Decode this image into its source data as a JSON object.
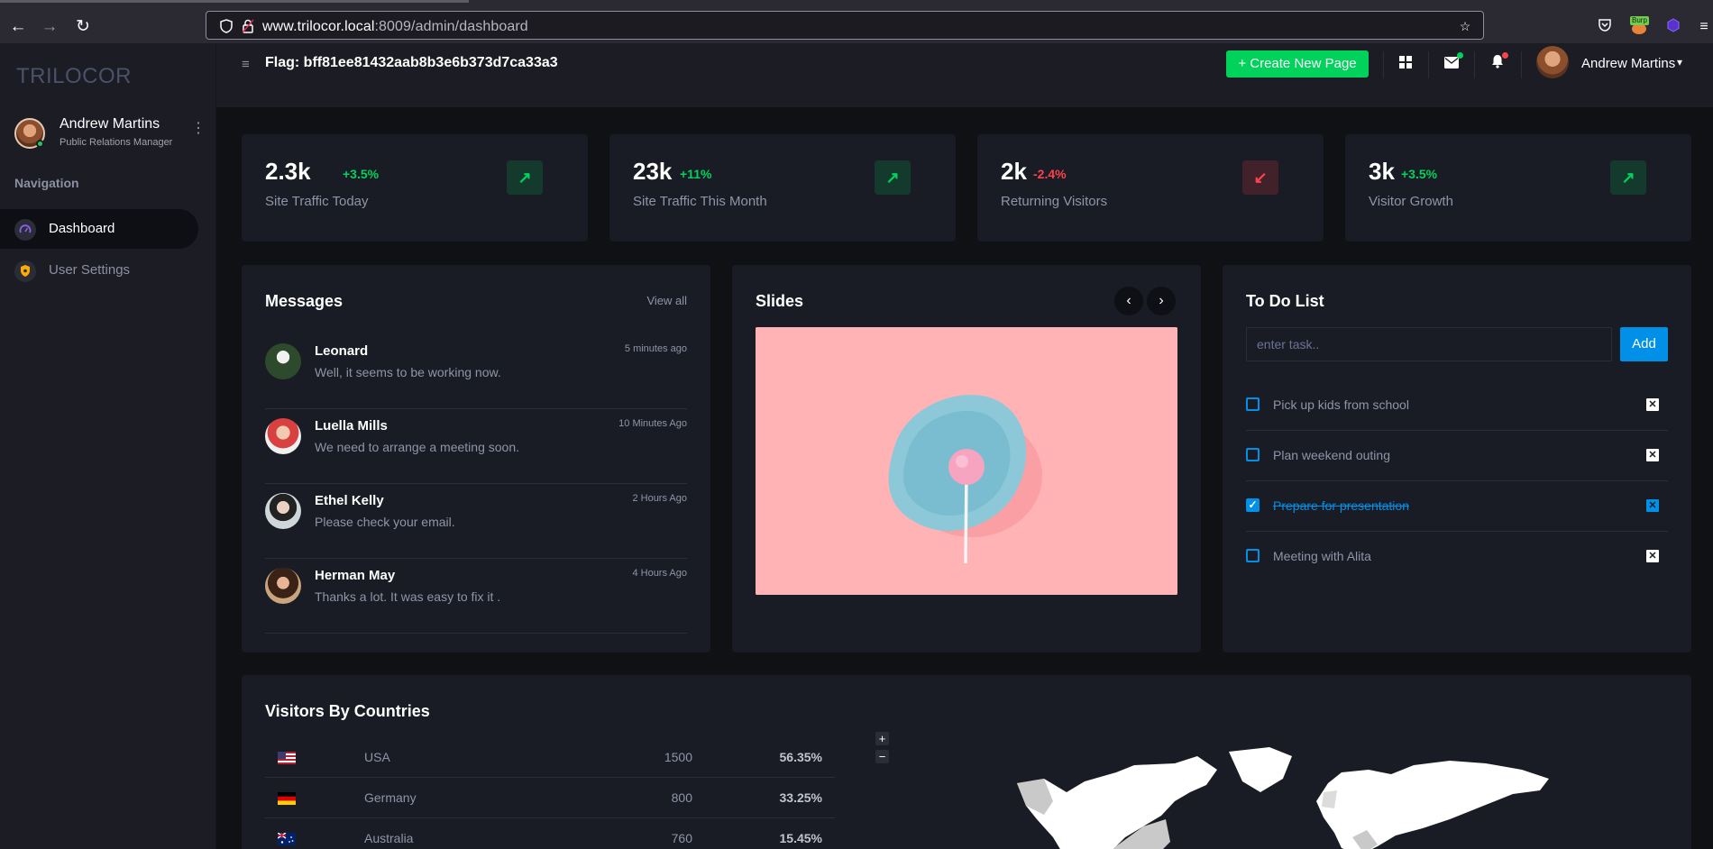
{
  "browser": {
    "url_host": "www.trilocor.local",
    "url_path": ":8009/admin/dashboard",
    "burp_badge": "Burp"
  },
  "brand": {
    "logo": "TRILOCOR"
  },
  "profile": {
    "name": "Andrew Martins",
    "role": "Public Relations Manager"
  },
  "nav": {
    "heading": "Navigation",
    "items": [
      {
        "label": "Dashboard",
        "active": true
      },
      {
        "label": "User Settings",
        "active": false
      }
    ]
  },
  "topbar": {
    "flag": "Flag: bff81ee81432aab8b3e6b373d7ca33a3",
    "create_button": "+ Create New Page",
    "user_name": "Andrew Martins"
  },
  "stats": [
    {
      "value": "2.3k",
      "change": "+3.5%",
      "label": "Site Traffic Today",
      "trend": "up"
    },
    {
      "value": "23k",
      "change": "+11%",
      "label": "Site Traffic This Month",
      "trend": "up"
    },
    {
      "value": "2k",
      "change": "-2.4%",
      "label": "Returning Visitors",
      "trend": "down"
    },
    {
      "value": "3k",
      "change": "+3.5%",
      "label": "Visitor Growth",
      "trend": "up"
    }
  ],
  "messages": {
    "title": "Messages",
    "view_all": "View all",
    "items": [
      {
        "name": "Leonard",
        "text": "Well, it seems to be working now.",
        "time": "5 minutes ago"
      },
      {
        "name": "Luella Mills",
        "text": "We need to arrange a meeting soon.",
        "time": "10 Minutes Ago"
      },
      {
        "name": "Ethel Kelly",
        "text": "Please check your email.",
        "time": "2 Hours Ago"
      },
      {
        "name": "Herman May",
        "text": "Thanks a lot. It was easy to fix it .",
        "time": "4 Hours Ago"
      }
    ]
  },
  "slides": {
    "title": "Slides"
  },
  "todo": {
    "title": "To Do List",
    "placeholder": "enter task..",
    "add_label": "Add",
    "items": [
      {
        "text": "Pick up kids from school",
        "done": false
      },
      {
        "text": "Plan weekend outing",
        "done": false
      },
      {
        "text": "Prepare for presentation",
        "done": true
      },
      {
        "text": "Meeting with Alita",
        "done": false
      }
    ]
  },
  "visitors": {
    "title": "Visitors By Countries",
    "rows": [
      {
        "country": "USA",
        "count": "1500",
        "percent": "56.35%"
      },
      {
        "country": "Germany",
        "count": "800",
        "percent": "33.25%"
      },
      {
        "country": "Australia",
        "count": "760",
        "percent": "15.45%"
      }
    ]
  },
  "icons": {
    "back": "arrow-left",
    "forward": "arrow-right",
    "reload": "reload",
    "grid": "grid-icon",
    "mail": "mail-icon",
    "bell": "bell-icon"
  },
  "colors": {
    "accent_green": "#00d25b",
    "accent_red": "#fc424a",
    "accent_blue": "#0090e7",
    "card_bg": "#191c24"
  }
}
